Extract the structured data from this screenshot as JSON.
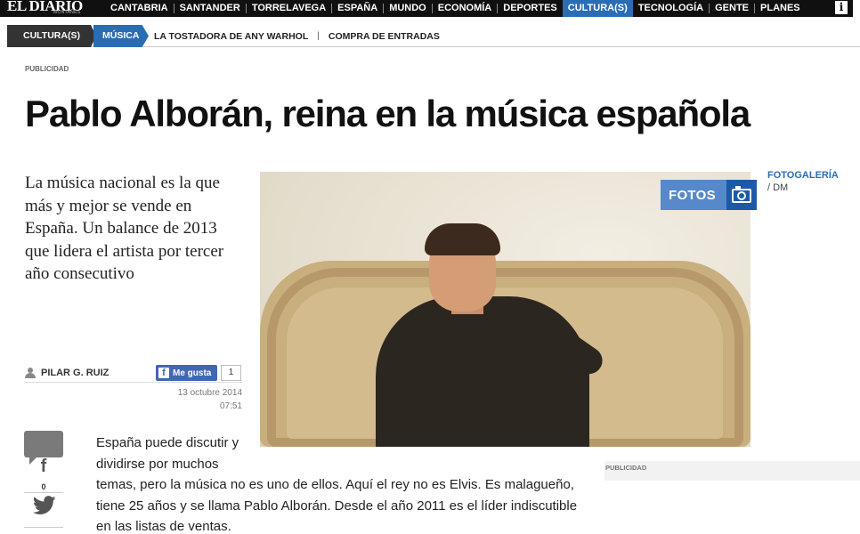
{
  "site": {
    "logo": "EL DIARIO",
    "logo_sub": "MONTAÑÉS"
  },
  "nav": {
    "items": [
      {
        "label": "CANTABRIA"
      },
      {
        "label": "SANTANDER"
      },
      {
        "label": "TORRELAVEGA"
      },
      {
        "label": "ESPAÑA"
      },
      {
        "label": "MUNDO"
      },
      {
        "label": "ECONOMÍA"
      },
      {
        "label": "DEPORTES"
      },
      {
        "label": "CULTURA(S)",
        "active": true
      },
      {
        "label": "TECNOLOGÍA"
      },
      {
        "label": "GENTE"
      },
      {
        "label": "PLANES"
      }
    ],
    "info": "i"
  },
  "subnav": {
    "section": "CULTURA(S)",
    "subsection": "MÚSICA",
    "links": [
      "LA TOSTADORA DE ANY WARHOL",
      "COMPRA DE ENTRADAS"
    ],
    "separator": "|"
  },
  "publicidad_top": "PUBLICIDAD",
  "article": {
    "headline": "Pablo Alborán, reina en la música española",
    "summary": "La música nacional es la que más y mejor se vende en España. Un balance de 2013 que lidera el artista por tercer año consecutivo",
    "author": "PILAR G. RUIZ",
    "fb_like_label": "Me gusta",
    "fb_like_count": "1",
    "date": "13 octubre 2014",
    "time": "07:51",
    "body_p1": "España puede discutir y dividirse por muchos",
    "body_p2": "temas, pero la música no es uno de ellos. Aquí el rey no es Elvis. Es malagueño, tiene 25 años y se llama Pablo Alborán. Desde el año 2011 es el líder indiscutible en las listas de ventas."
  },
  "photo": {
    "fotos_label": "FOTOS",
    "gallery_label": "FOTOGALERÍA",
    "credit": "/ DM"
  },
  "social": {
    "fb_glyph": "f",
    "share_count": "0"
  },
  "publicidad_right": "PUBLICIDAD",
  "colors": {
    "accent": "#2a6db5",
    "topbar": "#101010"
  }
}
